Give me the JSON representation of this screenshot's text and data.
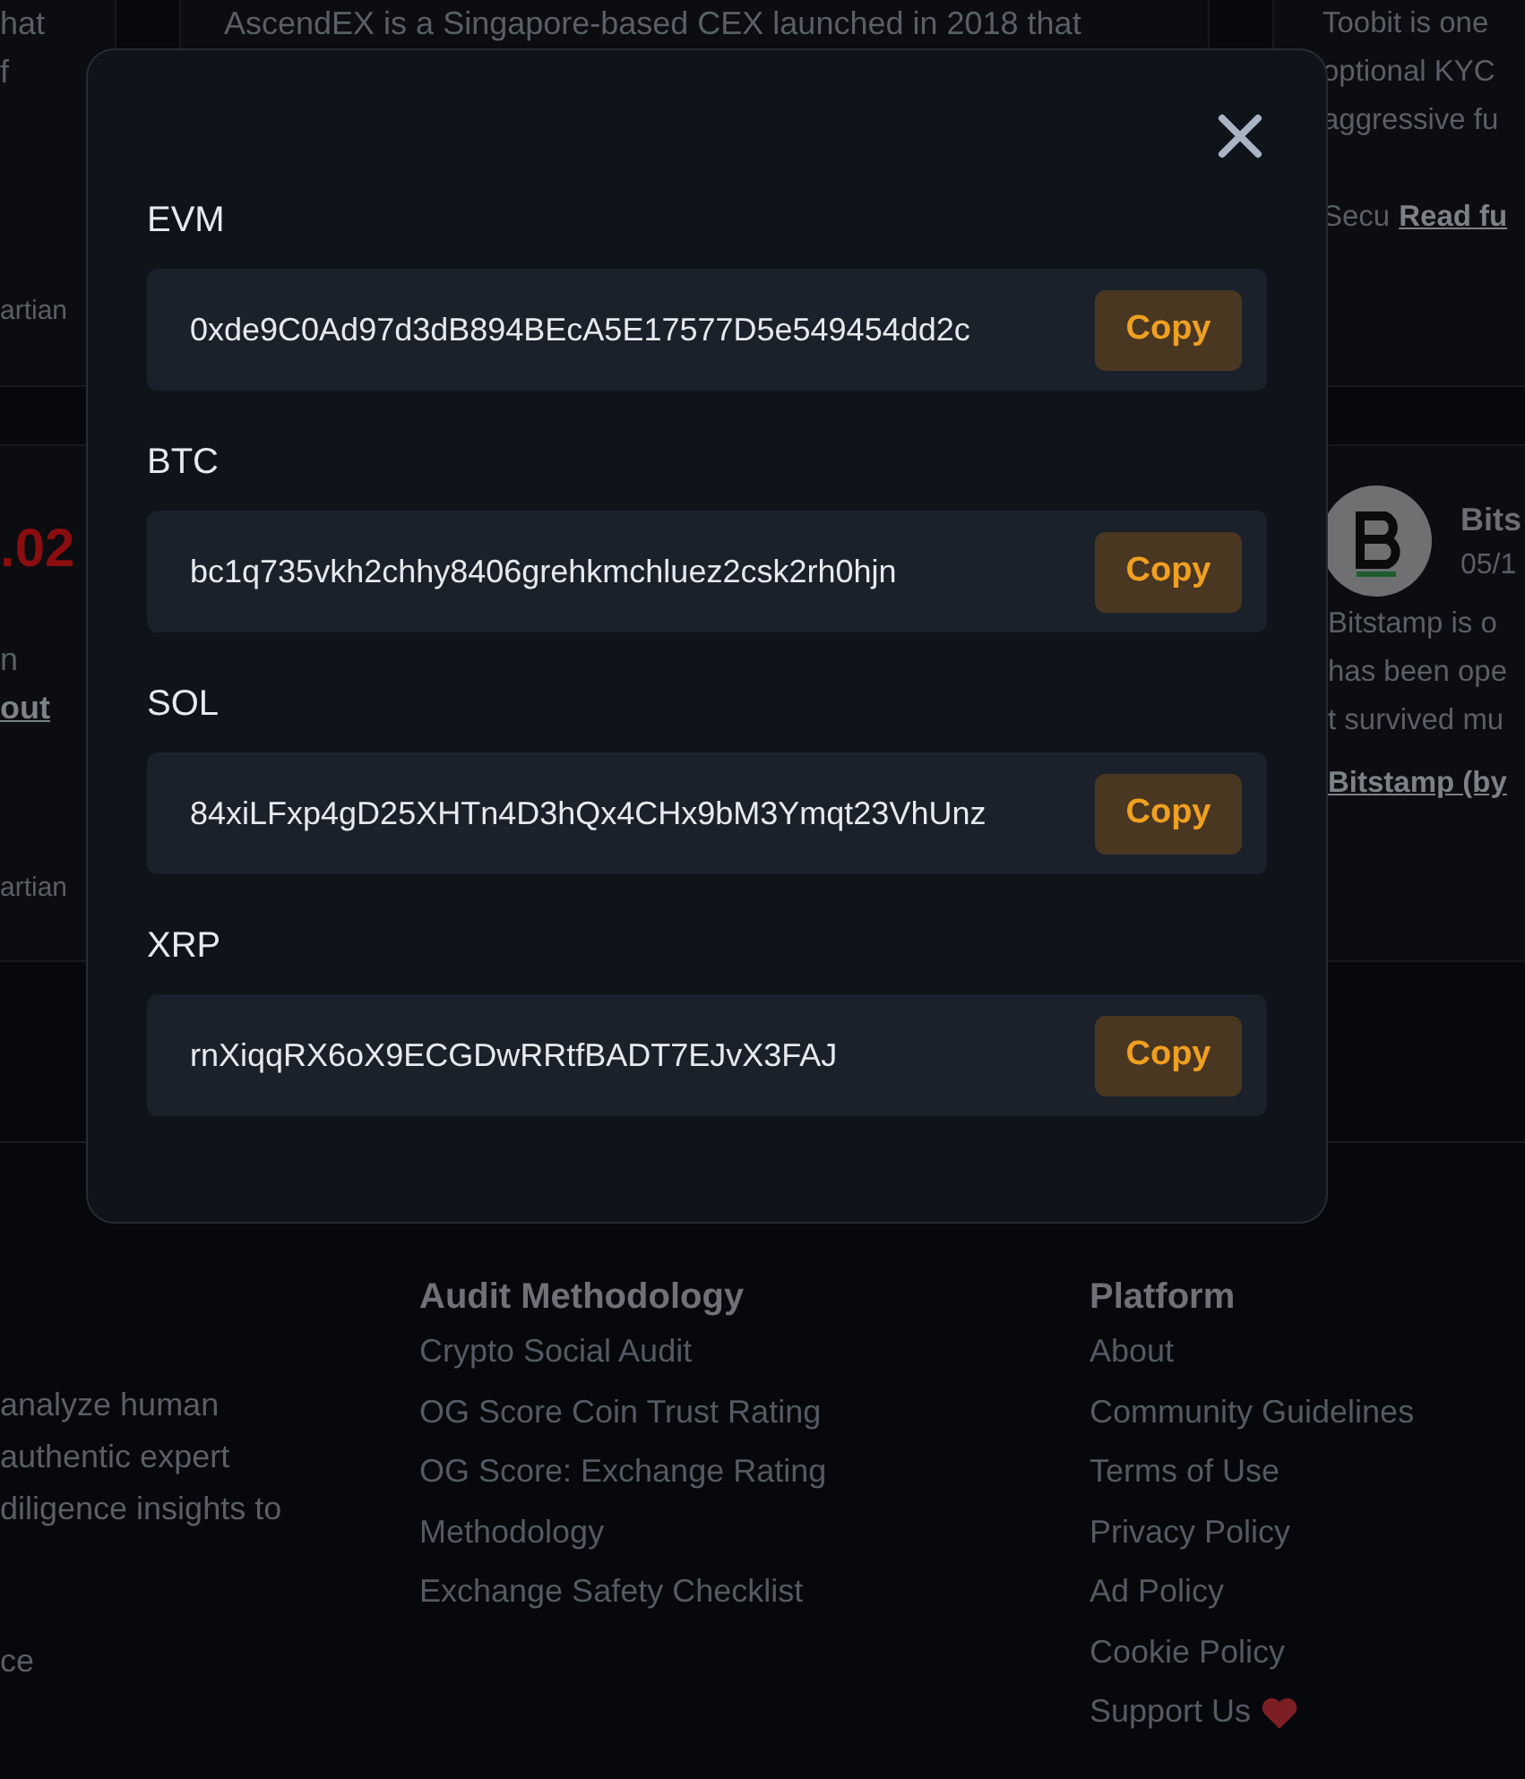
{
  "top_row": {
    "left": {
      "lines": [
        "hat",
        "f"
      ],
      "author": "artian"
    },
    "middle": {
      "lines": [
        "AscendEX is a Singapore-based CEX launched in 2018 that"
      ]
    },
    "right": {
      "lines": [
        "Toobit is one",
        "optional KYC",
        "aggressive fu"
      ],
      "trailing_text": "Secu",
      "link": "Read fu"
    }
  },
  "second_row": {
    "left": {
      "score": ".02",
      "lines": [
        "n"
      ],
      "link": "out",
      "author": "artian"
    },
    "right": {
      "name": "Bits",
      "date": "05/1",
      "lines": [
        "Bitstamp is o",
        "has been ope",
        "t survived mu"
      ],
      "link": "Bitstamp (by"
    }
  },
  "footer": {
    "about_lines": [
      "analyze human",
      "authentic expert",
      "diligence insights to"
    ],
    "about_tail": "ce",
    "columns": [
      {
        "heading": "Audit Methodology",
        "links": [
          {
            "label": "Crypto Social Audit",
            "kind": "plain"
          },
          {
            "label": "OG Score Coin Trust Rating",
            "kind": "plain"
          },
          {
            "label": "OG Score: Exchange Rating",
            "kind": "plain"
          },
          {
            "label": "Methodology",
            "kind": "plain"
          },
          {
            "label": "Exchange Safety Checklist",
            "kind": "plain"
          }
        ]
      },
      {
        "heading": "Platform",
        "links": [
          {
            "label": "About",
            "kind": "plain"
          },
          {
            "label": "Community Guidelines",
            "kind": "plain"
          },
          {
            "label": "Terms of Use",
            "kind": "plain"
          },
          {
            "label": "Privacy Policy",
            "kind": "plain"
          },
          {
            "label": "Ad Policy",
            "kind": "plain"
          },
          {
            "label": "Cookie Policy",
            "kind": "plain"
          },
          {
            "label": "Support Us",
            "kind": "heart"
          }
        ]
      }
    ]
  },
  "modal": {
    "addresses": [
      {
        "label": "EVM",
        "address": "0xde9C0Ad97d3dB894BEcA5E17577D5e549454dd2c",
        "button": "Copy"
      },
      {
        "label": "BTC",
        "address": "bc1q735vkh2chhy8406grehkmchluez2csk2rh0hjn",
        "button": "Copy"
      },
      {
        "label": "SOL",
        "address": "84xiLFxp4gD25XHTn4D3hQx4CHx9bM3Ymqt23VhUnz",
        "button": "Copy"
      },
      {
        "label": "XRP",
        "address": "rnXiqqRX6oX9ECGDwRRtfBADT7EJvX3FAJ",
        "button": "Copy"
      }
    ]
  }
}
